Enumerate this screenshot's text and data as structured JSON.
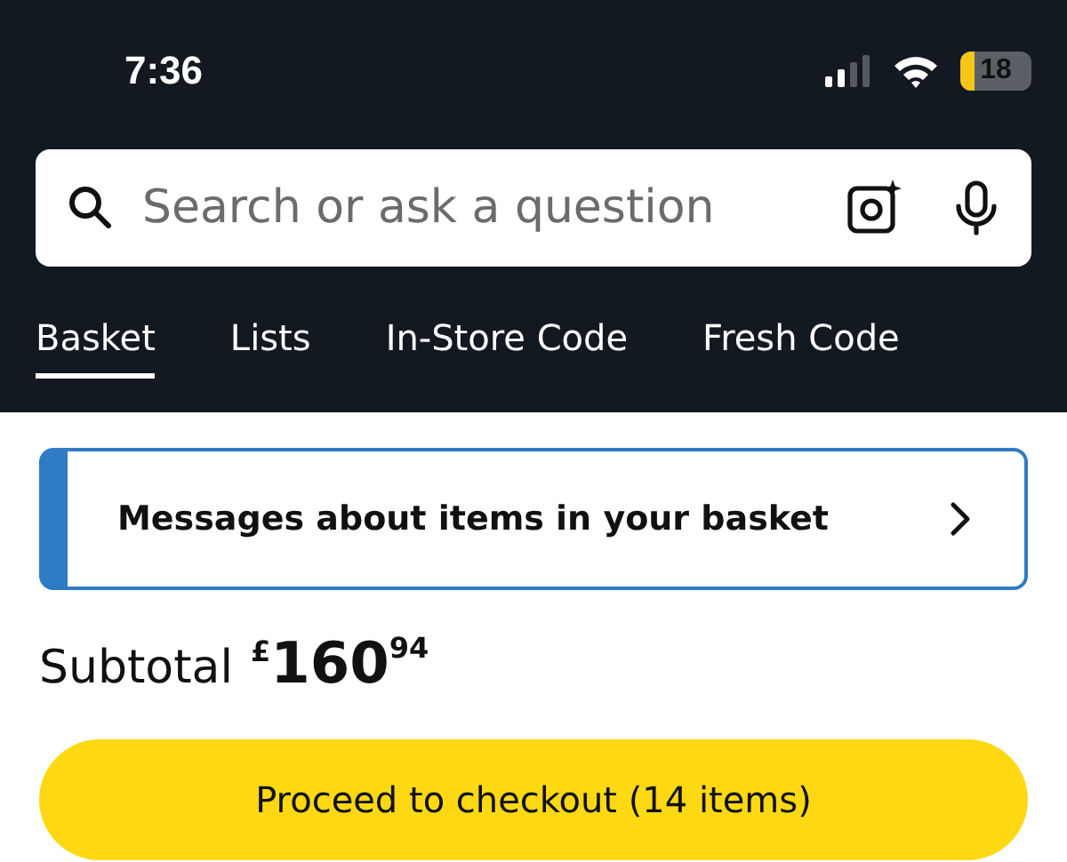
{
  "status_bar": {
    "time": "7:36",
    "battery": "18"
  },
  "search": {
    "placeholder": "Search or ask a question"
  },
  "tabs": [
    {
      "label": "Basket",
      "selected": true
    },
    {
      "label": "Lists",
      "selected": false
    },
    {
      "label": "In-Store Code",
      "selected": false
    },
    {
      "label": "Fresh Code",
      "selected": false
    }
  ],
  "messages_card": {
    "label": "Messages about items in your basket"
  },
  "subtotal": {
    "label": "Subtotal",
    "currency": "£",
    "whole": "160",
    "fraction": "94"
  },
  "checkout_button": {
    "label": "Proceed to checkout (14 items)"
  }
}
